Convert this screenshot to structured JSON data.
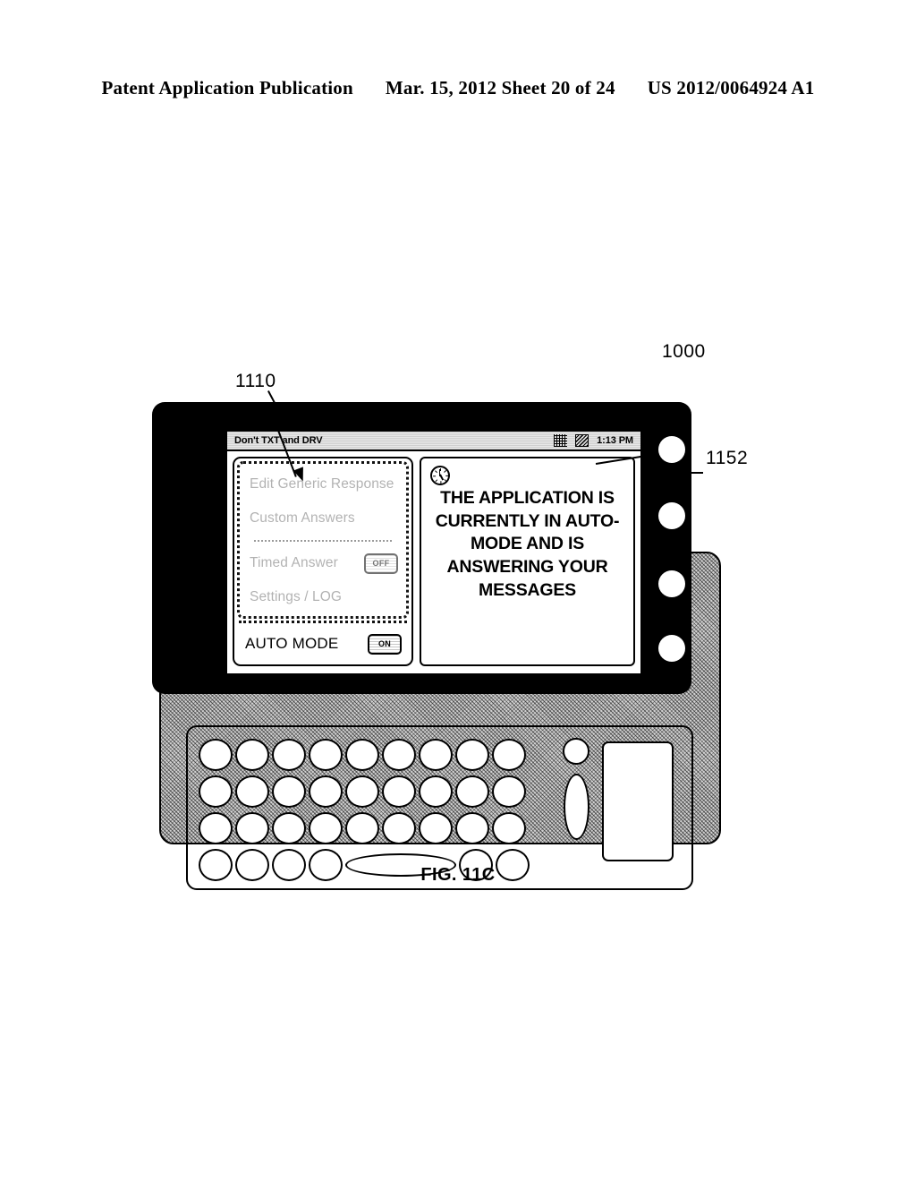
{
  "header": {
    "left": "Patent Application Publication",
    "middle": "Mar. 15, 2012  Sheet 20 of 24",
    "right": "US 2012/0064924 A1"
  },
  "figure": {
    "caption": "FIG. 11C",
    "reference_numbers": {
      "device": "1000",
      "menu_panel": "1110",
      "message_panel": "1152"
    }
  },
  "device": {
    "status_bar": {
      "title": "Don't TXT and DRV",
      "network_icon": "network-icon",
      "signal_icon": "signal-icon",
      "time": "1:13 PM"
    },
    "menu": {
      "disabled_items": [
        {
          "label": "Edit Generic Response",
          "state": "disabled",
          "toggle": null
        },
        {
          "label": "Custom Answers",
          "state": "disabled",
          "toggle": null
        },
        {
          "label": "Timed Answer",
          "state": "disabled",
          "toggle": "OFF"
        },
        {
          "label": "Settings / LOG",
          "state": "disabled",
          "toggle": null
        }
      ],
      "active_item": {
        "label": "AUTO MODE",
        "state": "enabled",
        "toggle": "ON"
      }
    },
    "message_panel": {
      "icon": "clock-icon",
      "text": "THE APPLICATION IS CURRENTLY IN AUTO-MODE AND IS ANSWERING YOUR MESSAGES"
    },
    "bezel_buttons": [
      "bezel-button-1",
      "bezel-button-2",
      "bezel-button-3",
      "bezel-button-4"
    ],
    "keyboard": {
      "row_key_counts": [
        9,
        9,
        9,
        4
      ],
      "has_spacebar": true,
      "trailing_keys_last_row": 2,
      "nav_round_key": "nav-round-key",
      "nav_oval_key": "nav-oval-key",
      "trackpad": "trackpad"
    }
  },
  "colors": {
    "ink": "#000000",
    "paper": "#ffffff",
    "body_grey": "#d2d2d2",
    "status_bar_grey": "#e8e8e8"
  }
}
